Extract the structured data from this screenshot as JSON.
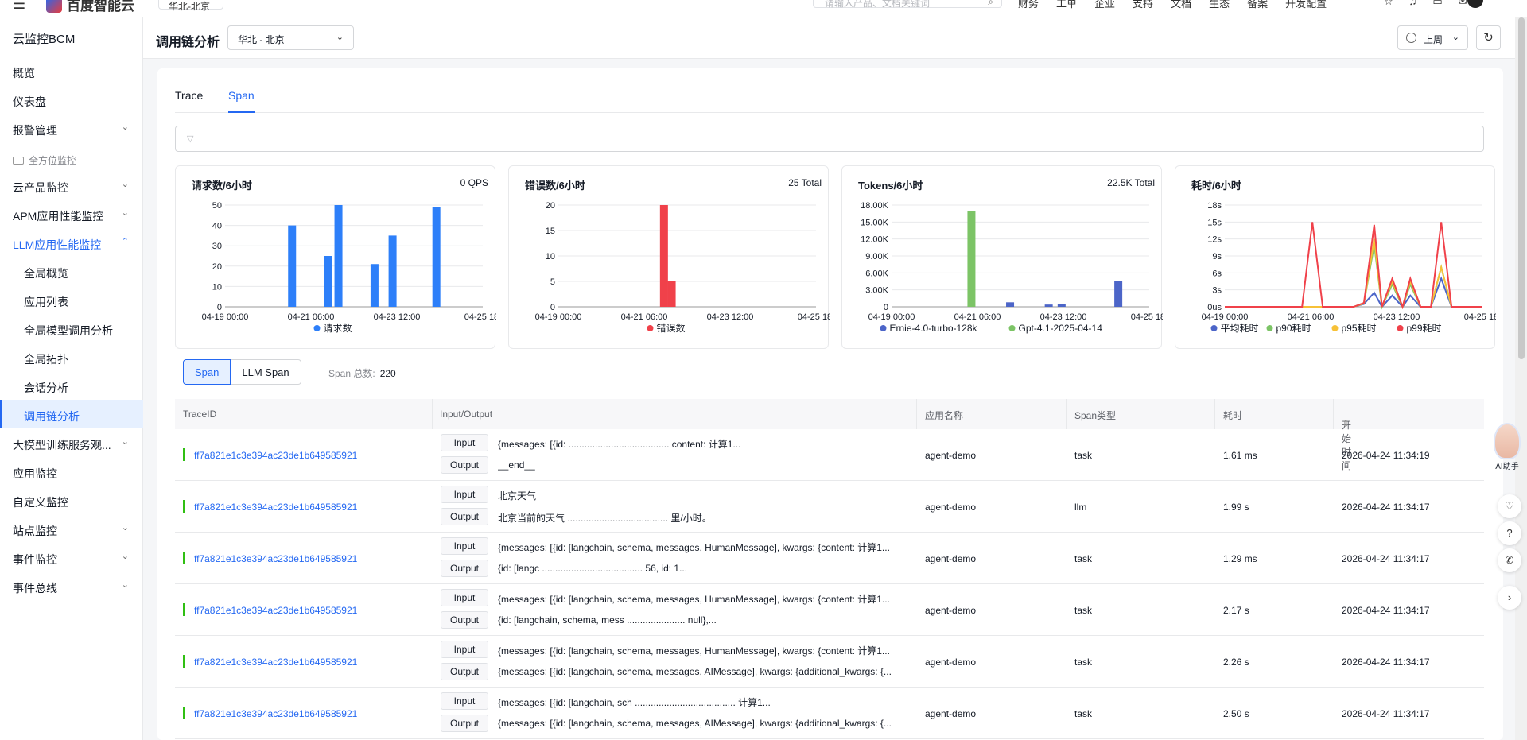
{
  "topbar": {
    "brand": "百度智能云",
    "region": "华北-北京",
    "search_placeholder": "请输入产品、文档关键词",
    "nav": [
      "财务",
      "工单",
      "企业",
      "支持",
      "文档",
      "生态",
      "备案",
      "开发配置"
    ]
  },
  "sidebar": {
    "product_title": "云监控BCM",
    "top_items": [
      "概览",
      "仪表盘",
      "报警管理"
    ],
    "group_label": "全方位监控",
    "groups": [
      {
        "label": "云产品监控",
        "expandable": true
      },
      {
        "label": "APM应用性能监控",
        "expandable": true
      },
      {
        "label": "LLM应用性能监控",
        "expandable": true,
        "open": true
      }
    ],
    "llm_children": [
      "全局概览",
      "应用列表",
      "全局模型调用分析",
      "全局拓扑",
      "会话分析",
      "调用链分析"
    ],
    "active_child": "调用链分析",
    "bottom_items": [
      {
        "label": "大模型训练服务观...",
        "expandable": true
      },
      {
        "label": "应用监控",
        "expandable": false
      },
      {
        "label": "自定义监控",
        "expandable": false
      },
      {
        "label": "站点监控",
        "expandable": true
      },
      {
        "label": "事件监控",
        "expandable": true
      },
      {
        "label": "事件总线",
        "expandable": true
      }
    ]
  },
  "header": {
    "title": "调用链分析",
    "region": "华北 - 北京",
    "time_range": "上周"
  },
  "tabs": [
    {
      "label": "Trace",
      "active": false
    },
    {
      "label": "Span",
      "active": true
    }
  ],
  "summary": {
    "seg": [
      "Span",
      "LLM Span"
    ],
    "active_seg": "Span",
    "total_label": "Span 总数:",
    "total_value": "220"
  },
  "chart_data": [
    {
      "type": "bar",
      "title": "请求数/6小时",
      "stat": "0 QPS",
      "x_ticks": [
        "04-19 00:00",
        "04-21 06:00",
        "04-23 12:00",
        "04-25 18:"
      ],
      "y_ticks": [
        "0",
        "10",
        "20",
        "30",
        "40",
        "50"
      ],
      "ylim": [
        0,
        50
      ],
      "series": [
        {
          "name": "请求数",
          "color": "#2d7ff9",
          "bars": [
            {
              "x": 0.26,
              "value": 40
            },
            {
              "x": 0.4,
              "value": 25
            },
            {
              "x": 0.44,
              "value": 50
            },
            {
              "x": 0.58,
              "value": 21
            },
            {
              "x": 0.65,
              "value": 35
            },
            {
              "x": 0.82,
              "value": 49
            }
          ]
        }
      ],
      "legend": [
        "请求数"
      ]
    },
    {
      "type": "bar",
      "title": "错误数/6小时",
      "stat": "25 Total",
      "x_ticks": [
        "04-19 00:00",
        "04-21 06:00",
        "04-23 12:00",
        "04-25 18:"
      ],
      "y_ticks": [
        "0",
        "5",
        "10",
        "15",
        "20"
      ],
      "ylim": [
        0,
        20
      ],
      "series": [
        {
          "name": "错误数",
          "color": "#f0414a",
          "bars": [
            {
              "x": 0.41,
              "value": 20
            },
            {
              "x": 0.44,
              "value": 5
            }
          ]
        }
      ],
      "legend": [
        "错误数"
      ]
    },
    {
      "type": "bar",
      "title": "Tokens/6小时",
      "stat": "22.5K Total",
      "x_ticks": [
        "04-19 00:00",
        "04-21 06:00",
        "04-23 12:00",
        "04-25 18:"
      ],
      "y_ticks": [
        "0",
        "3.00K",
        "6.00K",
        "9.00K",
        "12.00K",
        "15.00K",
        "18.00K"
      ],
      "ylim": [
        0,
        18000
      ],
      "series": [
        {
          "name": "Ernie-4.0-turbo-128k",
          "color": "#4c65c8",
          "bars": [
            {
              "x": 0.46,
              "value": 800
            },
            {
              "x": 0.61,
              "value": 400
            },
            {
              "x": 0.66,
              "value": 500
            },
            {
              "x": 0.88,
              "value": 4500
            }
          ]
        },
        {
          "name": "Gpt-4.1-2025-04-14",
          "color": "#7cc466",
          "bars": [
            {
              "x": 0.31,
              "value": 17000
            }
          ]
        }
      ],
      "legend": [
        "Ernie-4.0-turbo-128k",
        "Gpt-4.1-2025-04-14"
      ]
    },
    {
      "type": "line",
      "title": "耗时/6小时",
      "stat": "",
      "x_ticks": [
        "04-19 00:00",
        "04-21 06:00",
        "04-23 12:00",
        "04-25 18:"
      ],
      "y_ticks": [
        "0us",
        "3s",
        "6s",
        "9s",
        "12s",
        "15s",
        "18s"
      ],
      "ylim": [
        0,
        18
      ],
      "x_points": [
        0,
        0.1,
        0.2,
        0.3,
        0.34,
        0.38,
        0.44,
        0.5,
        0.54,
        0.58,
        0.61,
        0.65,
        0.69,
        0.72,
        0.76,
        0.8,
        0.84,
        0.88,
        0.91,
        0.95,
        1.0
      ],
      "series": [
        {
          "name": "平均耗时",
          "color": "#4c65c8",
          "values": [
            0,
            0,
            0,
            0,
            0,
            0,
            0,
            0,
            0.5,
            2.5,
            0,
            2,
            0,
            2,
            0,
            0,
            5,
            0,
            0,
            0,
            0
          ]
        },
        {
          "name": "p90耗时",
          "color": "#7cc466",
          "values": [
            0,
            0,
            0,
            0,
            0,
            0,
            0,
            0,
            0.6,
            11,
            0,
            4,
            0,
            4,
            0,
            0,
            7,
            0,
            0,
            0,
            0
          ]
        },
        {
          "name": "p95耗时",
          "color": "#f7c137",
          "values": [
            0,
            0,
            0,
            0,
            0,
            0,
            0,
            0,
            0.6,
            12,
            0,
            4.5,
            0,
            4.5,
            0,
            0,
            7,
            0,
            0,
            0,
            0
          ]
        },
        {
          "name": "p99耗时",
          "color": "#f0414a",
          "values": [
            0,
            0,
            0,
            0,
            15,
            0,
            0,
            0,
            0.7,
            14.5,
            0,
            5,
            0,
            5,
            0,
            0,
            15,
            0,
            0,
            0,
            0
          ]
        }
      ],
      "legend": [
        "平均耗时",
        "p90耗时",
        "p95耗时",
        "p99耗时"
      ]
    }
  ],
  "table": {
    "columns": [
      "TraceID",
      "Input/Output",
      "应用名称",
      "Span类型",
      "耗时",
      "开始时间"
    ],
    "input_label": "Input",
    "output_label": "Output",
    "rows": [
      {
        "trace_id": "ff7a821e1c3e394ac23de1b649585921",
        "input": "{messages: [{id: ...................................... content: 计算1...",
        "output": "__end__",
        "app": "agent-demo",
        "type": "task",
        "duration": "1.61 ms",
        "start": "2026-04-24 11:34:19"
      },
      {
        "trace_id": "ff7a821e1c3e394ac23de1b649585921",
        "input": "北京天气",
        "output": "北京当前的天气 ...................................... 里/小时。",
        "app": "agent-demo",
        "type": "llm",
        "duration": "1.99 s",
        "start": "2026-04-24 11:34:17"
      },
      {
        "trace_id": "ff7a821e1c3e394ac23de1b649585921",
        "input": "{messages: [{id: [langchain, schema, messages, HumanMessage], kwargs: {content: 计算1...",
        "output": "{id: [langc ...................................... 56, id: 1...",
        "app": "agent-demo",
        "type": "task",
        "duration": "1.29 ms",
        "start": "2026-04-24 11:34:17"
      },
      {
        "trace_id": "ff7a821e1c3e394ac23de1b649585921",
        "input": "{messages: [{id: [langchain, schema, messages, HumanMessage], kwargs: {content: 计算1...",
        "output": "{id: [langchain, schema, mess ...................... null},...",
        "app": "agent-demo",
        "type": "task",
        "duration": "2.17 s",
        "start": "2026-04-24 11:34:17"
      },
      {
        "trace_id": "ff7a821e1c3e394ac23de1b649585921",
        "input": "{messages: [{id: [langchain, schema, messages, HumanMessage], kwargs: {content: 计算1...",
        "output": "{messages: [{id: [langchain, schema, messages, AIMessage], kwargs: {additional_kwargs: {...",
        "app": "agent-demo",
        "type": "task",
        "duration": "2.26 s",
        "start": "2026-04-24 11:34:17"
      },
      {
        "trace_id": "ff7a821e1c3e394ac23de1b649585921",
        "input": "{messages: [{id: [langchain, sch ...................................... 计算1...",
        "output": "{messages: [{id: [langchain, schema, messages, AIMessage], kwargs: {additional_kwargs: {...",
        "app": "agent-demo",
        "type": "task",
        "duration": "2.50 s",
        "start": "2026-04-24 11:34:17"
      }
    ]
  },
  "ai_helper": "AI助手"
}
